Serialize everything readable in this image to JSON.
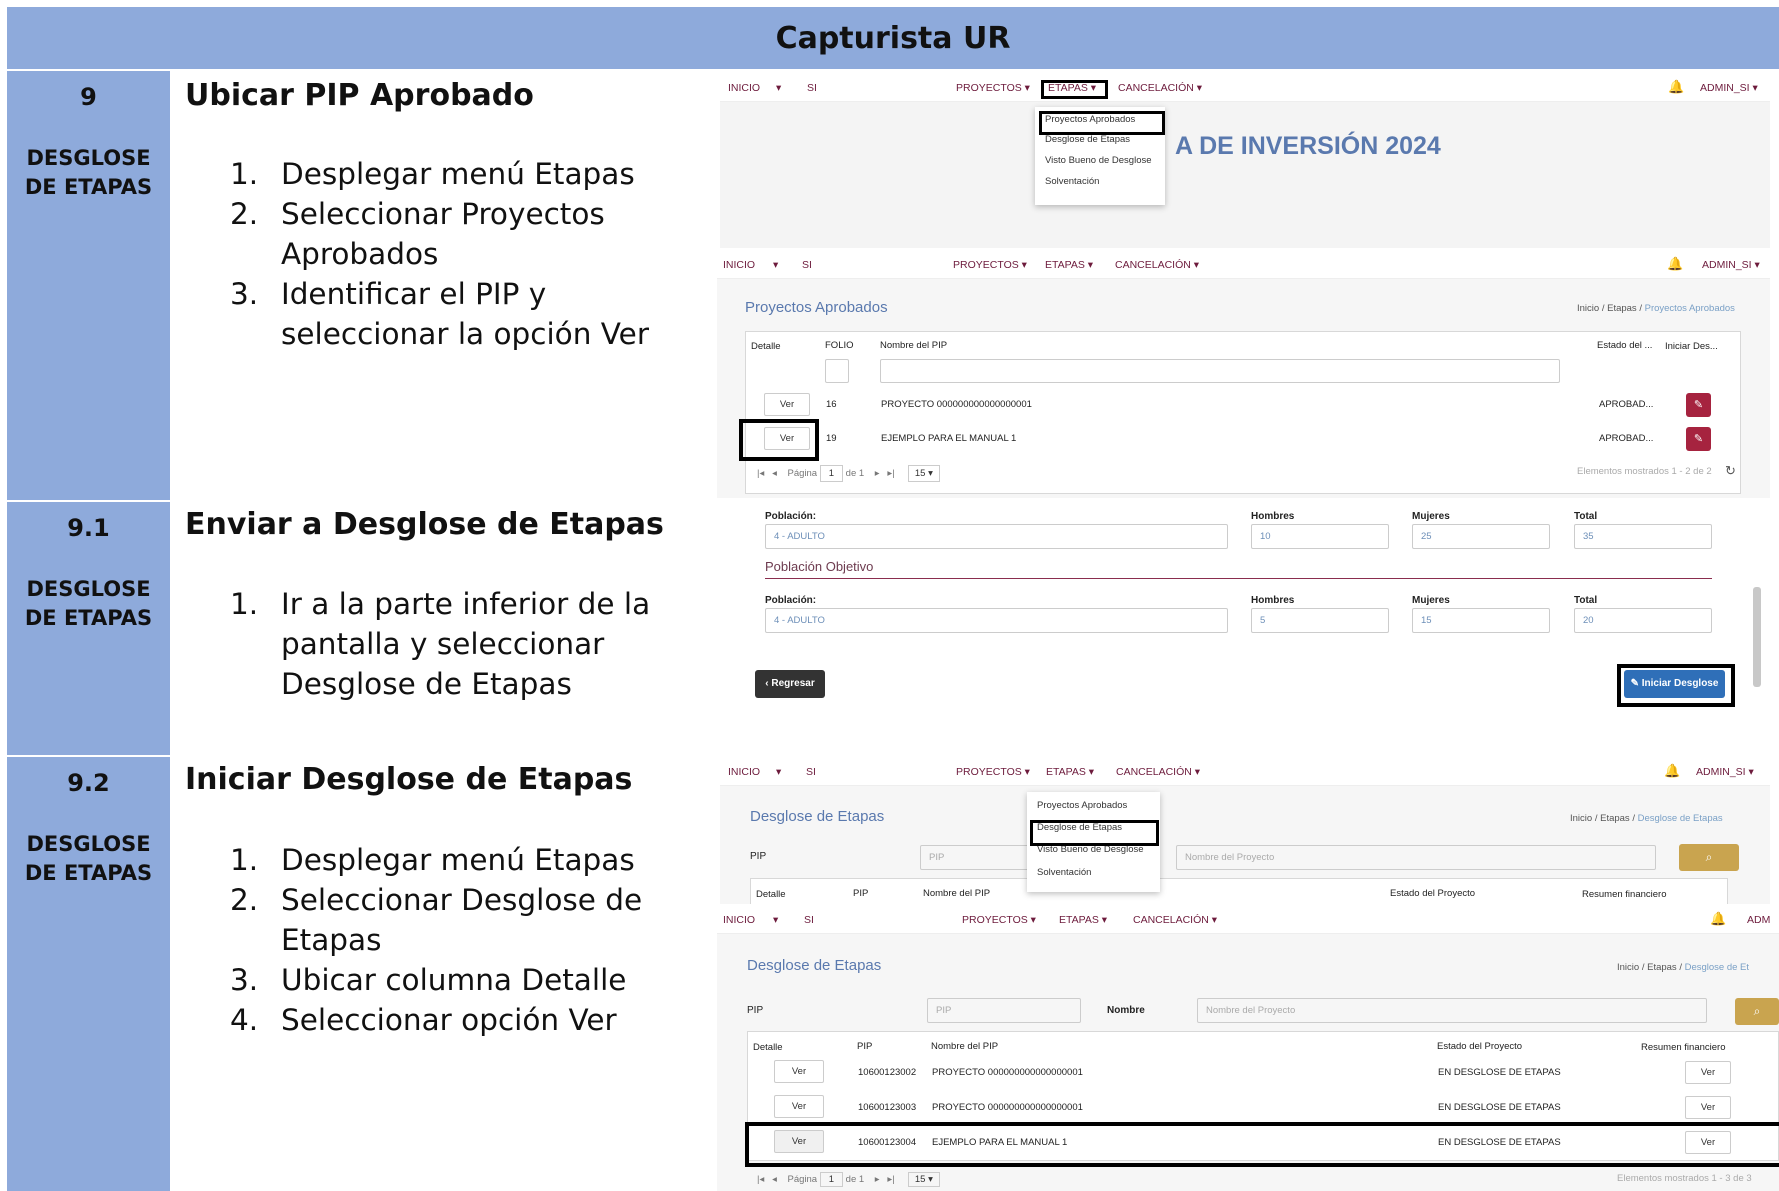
{
  "header": {
    "title": "Capturista UR"
  },
  "sections": [
    {
      "num": "9",
      "tag": "DESGLOSE DE ETAPAS",
      "title": "Ubicar PIP Aprobado",
      "steps": [
        {
          "n": "1.",
          "t": "Desplegar menú Etapas"
        },
        {
          "n": "2.",
          "t": "Seleccionar Proyectos Aprobados"
        },
        {
          "n": "3.",
          "t": "Identificar el PIP y seleccionar la opción Ver"
        }
      ]
    },
    {
      "num": "9.1",
      "tag": "DESGLOSE DE ETAPAS",
      "title": "Enviar a Desglose de Etapas",
      "steps": [
        {
          "n": "1.",
          "t": "Ir a la parte inferior de la pantalla y seleccionar Desglose de Etapas"
        }
      ]
    },
    {
      "num": "9.2",
      "tag": "DESGLOSE DE ETAPAS",
      "title": "Iniciar Desglose de Etapas",
      "steps": [
        {
          "n": "1.",
          "t": "Desplegar menú Etapas"
        },
        {
          "n": "2.",
          "t": "Seleccionar Desglose de Etapas"
        },
        {
          "n": "3.",
          "t": "Ubicar columna Detalle"
        },
        {
          "n": "4.",
          "t": "Seleccionar opción Ver"
        }
      ]
    }
  ],
  "nav": {
    "inicio": "INICIO",
    "caret": "▾",
    "si": "SI",
    "proyectos": "PROYECTOS ▾",
    "etapas": "ETAPAS ▾",
    "cancelacion": "CANCELACIÓN ▾",
    "admin": "ADMIN_SI ▾",
    "admin_cut": "ADM"
  },
  "menu_etapas": [
    "Proyectos Aprobados",
    "Desglose de Etapas",
    "Visto Bueno de Desglose",
    "Solventación"
  ],
  "banner": "A DE INVERSIÓN 2024",
  "aprobados": {
    "title": "Proyectos Aprobados",
    "breadcrumb": [
      "Inicio",
      "/",
      "Etapas",
      "/",
      "Proyectos Aprobados"
    ],
    "columns": [
      "Detalle",
      "FOLIO",
      "Nombre del PIP",
      "Estado del ...",
      "Iniciar Des..."
    ],
    "rows": [
      {
        "ver": "Ver",
        "folio": "16",
        "nombre": "PROYECTO 000000000000000001",
        "estado": "APROBAD..."
      },
      {
        "ver": "Ver",
        "folio": "19",
        "nombre": "EJEMPLO PARA EL MANUAL 1",
        "estado": "APROBAD..."
      }
    ],
    "pager": {
      "pagina": "Página",
      "page": "1",
      "de": "de 1",
      "size": "15 ▾",
      "info": "Elementos mostrados 1 - 2 de 2"
    }
  },
  "detalle": {
    "poblacion_label": "Población:",
    "hombres_label": "Hombres",
    "mujeres_label": "Mujeres",
    "total_label": "Total",
    "row1": {
      "poblacion": "4 - ADULTO",
      "hombres": "10",
      "mujeres": "25",
      "total": "35"
    },
    "objetivo_title": "Población Objetivo",
    "row2": {
      "poblacion": "4 - ADULTO",
      "hombres": "5",
      "mujeres": "15",
      "total": "20"
    },
    "regresar": "Regresar",
    "iniciar": "Iniciar Desglose"
  },
  "desglose_menu_shot": {
    "title": "Desglose de Etapas",
    "breadcrumb": [
      "Inicio",
      "/",
      "Etapas",
      "/",
      "Desglose de Etapas"
    ],
    "pip_label": "PIP",
    "pip_placeholder": "PIP",
    "nombre_placeholder": "Nombre del Proyecto",
    "columns": [
      "Detalle",
      "PIP",
      "Nombre del PIP",
      "Estado del Proyecto",
      "Resumen financiero"
    ]
  },
  "desglose": {
    "title": "Desglose de Etapas",
    "breadcrumb": [
      "Inicio",
      "/",
      "Etapas",
      "/",
      "Desglose de Et"
    ],
    "pip_label": "PIP",
    "pip_placeholder": "PIP",
    "nombre_label": "Nombre",
    "nombre_placeholder": "Nombre del Proyecto",
    "columns": [
      "Detalle",
      "PIP",
      "Nombre del PIP",
      "Estado del Proyecto",
      "Resumen financiero"
    ],
    "rows": [
      {
        "ver": "Ver",
        "pip": "10600123002",
        "nombre": "PROYECTO 000000000000000001",
        "estado": "EN DESGLOSE DE ETAPAS",
        "resumen": "Ver"
      },
      {
        "ver": "Ver",
        "pip": "10600123003",
        "nombre": "PROYECTO 000000000000000001",
        "estado": "EN DESGLOSE DE ETAPAS",
        "resumen": "Ver"
      },
      {
        "ver": "Ver",
        "pip": "10600123004",
        "nombre": "EJEMPLO PARA EL MANUAL 1",
        "estado": "EN DESGLOSE DE ETAPAS",
        "resumen": "Ver"
      }
    ],
    "pager": {
      "pagina": "Página",
      "page": "1",
      "de": "de 1",
      "size": "15 ▾",
      "info": "Elementos mostrados 1 - 3 de 3"
    }
  },
  "icons": {
    "bell": "bell-icon",
    "search": "search-icon",
    "refresh": "refresh-icon",
    "pencil": "pencil-icon"
  }
}
